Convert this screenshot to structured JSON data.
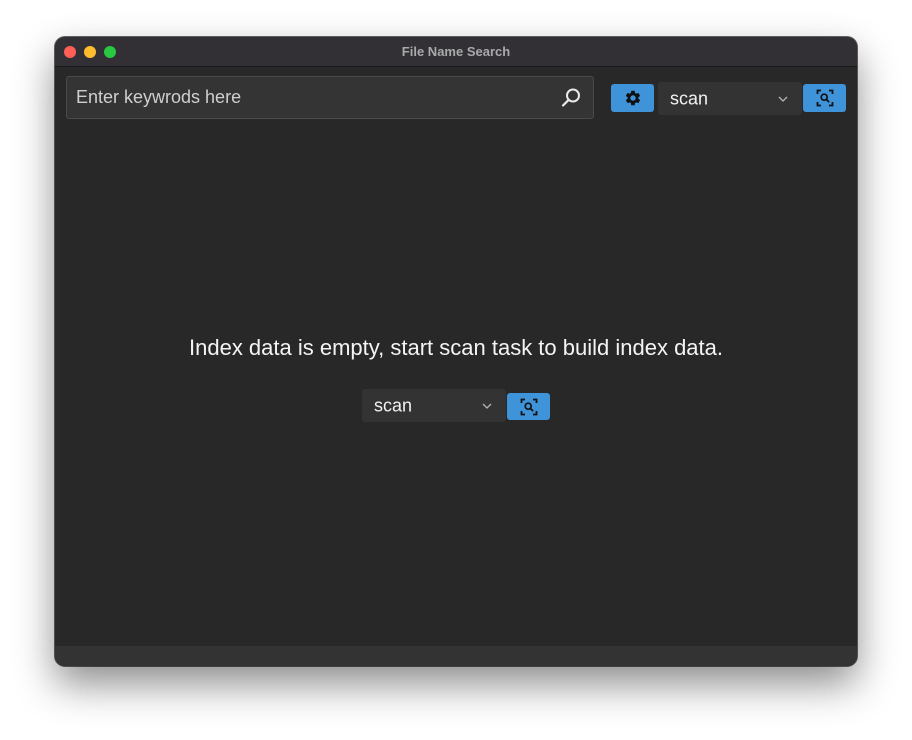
{
  "window": {
    "title": "File Name Search"
  },
  "search": {
    "placeholder": "Enter keywrods here",
    "value": ""
  },
  "toolbar": {
    "settings_icon": "gear-icon",
    "scan_select_value": "scan",
    "scan_button_icon": "scan-search-icon"
  },
  "empty_state": {
    "message": "Index data is empty, start scan task to build index data.",
    "scan_select_value": "scan",
    "scan_button_icon": "scan-search-icon"
  },
  "colors": {
    "window_bg": "#282828",
    "titlebar_bg": "#323034",
    "accent": "#3f93d9",
    "select_bg": "#333333"
  }
}
